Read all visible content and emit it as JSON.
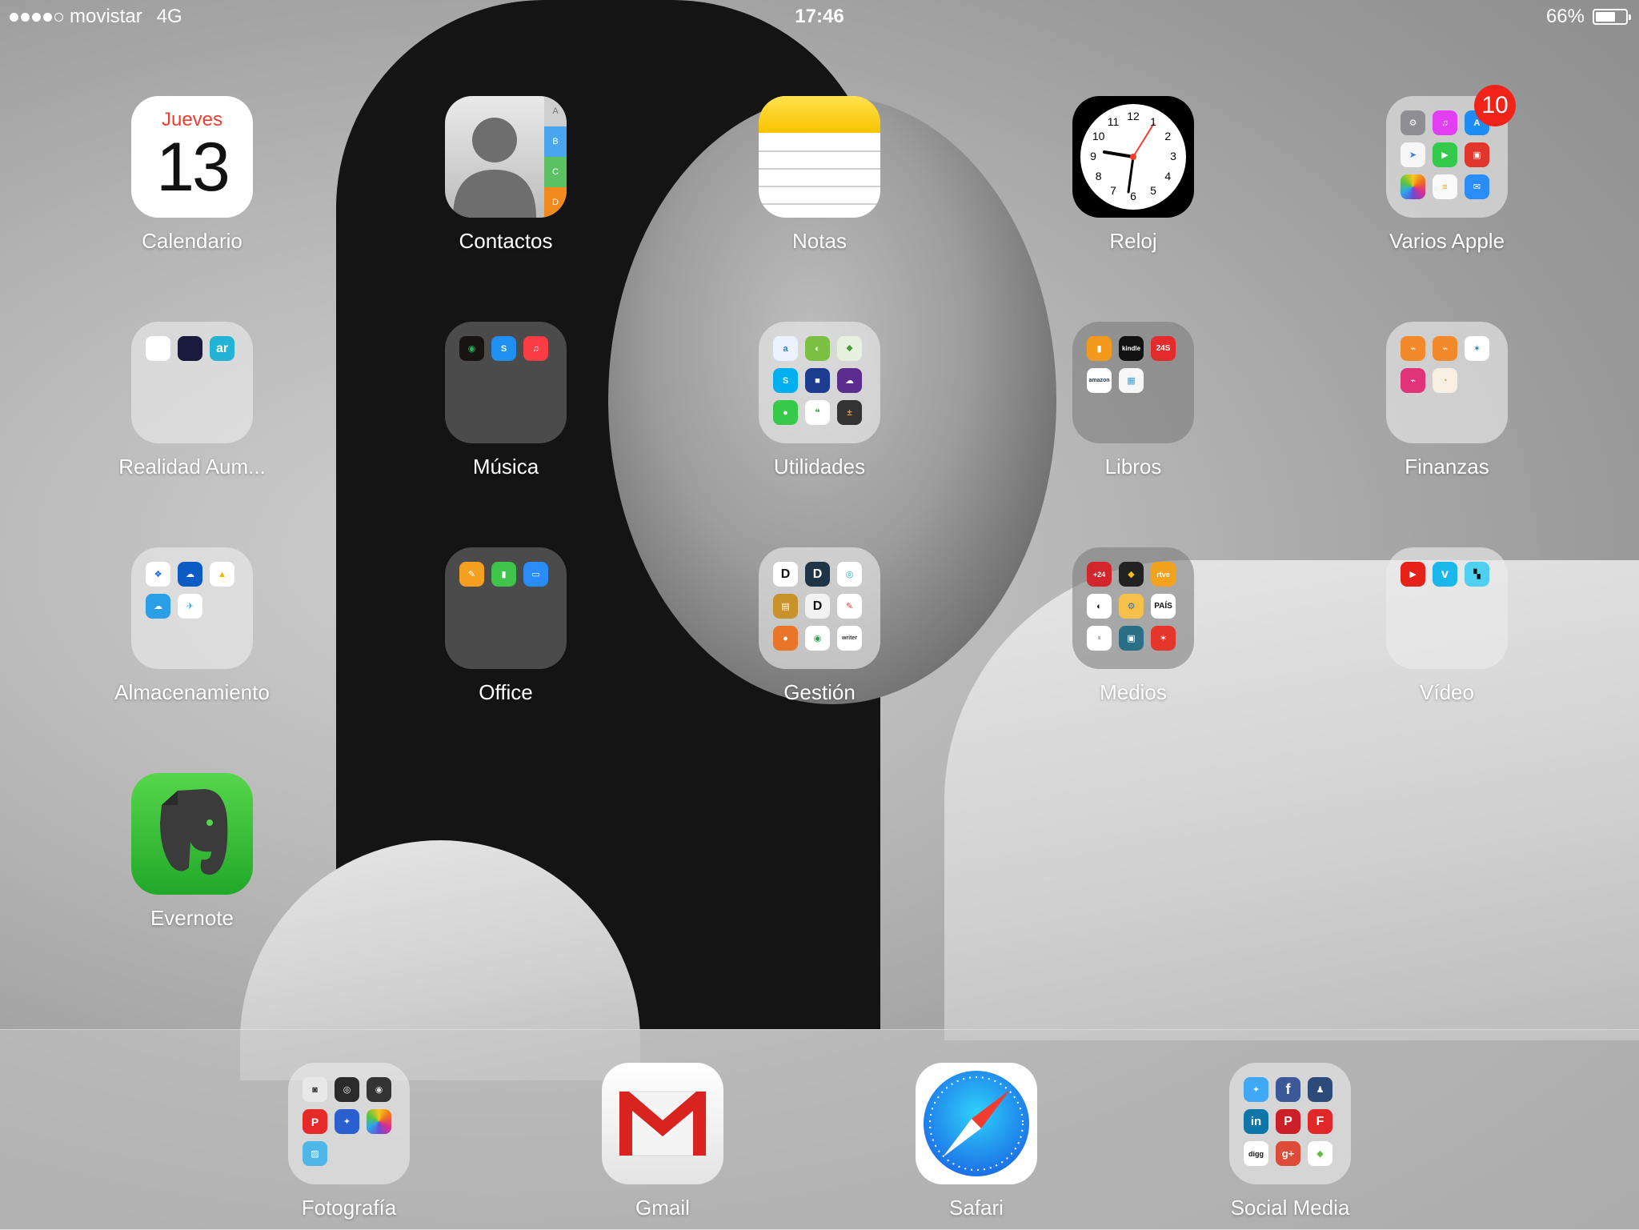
{
  "status_bar": {
    "carrier": "movistar",
    "network": "4G",
    "time": "17:46",
    "battery_percent": "66%",
    "battery_level": 0.66,
    "signal_bars": 4
  },
  "home": {
    "calendar": {
      "label": "Calendario",
      "weekday": "Jueves",
      "day": "13"
    },
    "contacts": {
      "label": "Contactos",
      "tabs": [
        "A",
        "B",
        "C",
        "D"
      ]
    },
    "notes": {
      "label": "Notas"
    },
    "clock": {
      "label": "Reloj",
      "numbers": [
        "12",
        "1",
        "2",
        "3",
        "4",
        "5",
        "6",
        "7",
        "8",
        "9",
        "10",
        "11"
      ]
    },
    "varios_apple": {
      "label": "Varios Apple",
      "badge": "10"
    },
    "realidad": {
      "label": "Realidad Aum...",
      "mini_text": [
        "",
        "",
        "ar"
      ]
    },
    "musica": {
      "label": "Música"
    },
    "utilidades": {
      "label": "Utilidades"
    },
    "libros": {
      "label": "Libros",
      "mini_text": [
        "",
        "kindle",
        "24S",
        "amazon",
        ""
      ]
    },
    "finanzas": {
      "label": "Finanzas"
    },
    "almacenamiento": {
      "label": "Almacenamiento"
    },
    "office": {
      "label": "Office"
    },
    "gestion": {
      "label": "Gestión",
      "mini_text": [
        "D",
        "D",
        "",
        "",
        "D",
        "",
        "",
        "",
        "writer"
      ]
    },
    "medios": {
      "label": "Medios",
      "mini_text": [
        "+24",
        "",
        "rtve",
        "",
        "",
        "PAÍS",
        "",
        "",
        ""
      ]
    },
    "video": {
      "label": "Vídeo",
      "mini_text": [
        "",
        "v",
        ""
      ]
    },
    "evernote": {
      "label": "Evernote"
    }
  },
  "dock": {
    "fotografia": {
      "label": "Fotografía",
      "mini_text": [
        "",
        "",
        "",
        "P",
        "",
        "",
        ""
      ]
    },
    "gmail": {
      "label": "Gmail"
    },
    "safari": {
      "label": "Safari"
    },
    "social_media": {
      "label": "Social Media",
      "mini_text": [
        "",
        "f",
        "",
        "in",
        "P",
        "F",
        "digg",
        "g+",
        ""
      ]
    }
  },
  "colors": {
    "badge": "#f0231b",
    "calendar_red": "#f33b2e",
    "notes_yellow": "#f8c400",
    "evernote_green": "#2db52e"
  }
}
